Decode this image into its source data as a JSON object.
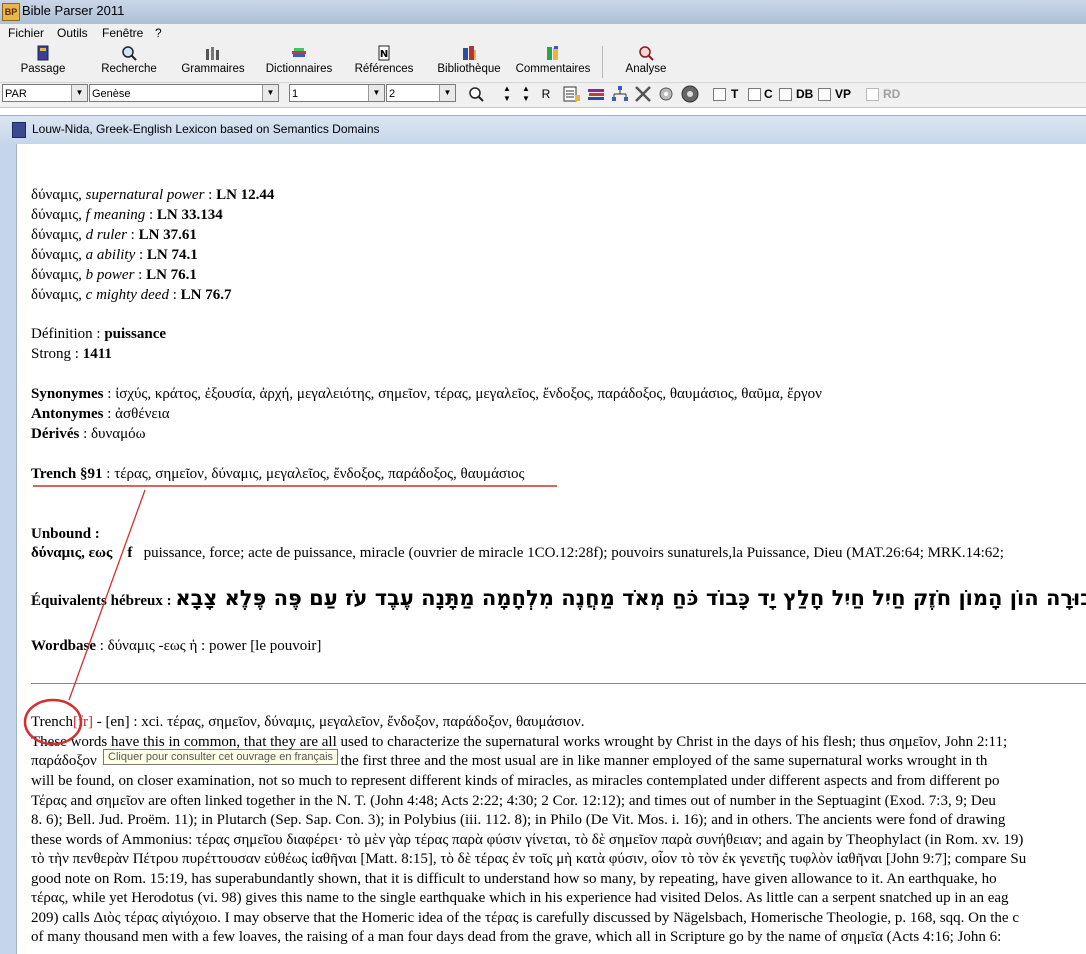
{
  "app": {
    "title": "Bible Parser 2011",
    "icon_text": "BP"
  },
  "menu": [
    "Fichier",
    "Outils",
    "Fenêtre",
    "?"
  ],
  "toolbar": {
    "buttons": [
      "Passage",
      "Recherche",
      "Grammaires",
      "Dictionnaires",
      "Références",
      "Bibliothèque",
      "Commentaires",
      "Analyse"
    ],
    "icons": [
      "book-icon",
      "magnifier-icon",
      "columns-icon",
      "dictionary-icon",
      "references-icon",
      "library-icon",
      "commentary-icon",
      "analysis-icon"
    ]
  },
  "toolbar2": {
    "version": "PAR",
    "book": "Genèse",
    "chapter": "1",
    "verse": "2",
    "r_label": "R",
    "checkboxes": [
      "T",
      "C",
      "DB",
      "VP",
      "RD"
    ]
  },
  "window": {
    "title": "Louw-Nida, Greek-English Lexicon based on Semantics Domains"
  },
  "entries": [
    {
      "word": "δύναμις, ",
      "sense": "supernatural power",
      "sep": " : ",
      "ref": "LN 12.44"
    },
    {
      "word": "δύναμις, ",
      "sense": "f meaning",
      "sep": " : ",
      "ref": "LN 33.134"
    },
    {
      "word": "δύναμις, ",
      "sense": "d ruler",
      "sep": " : ",
      "ref": "LN 37.61"
    },
    {
      "word": "δύναμις, ",
      "sense": "a ability",
      "sep": " : ",
      "ref": "LN 74.1"
    },
    {
      "word": "δύναμις, ",
      "sense": "b power",
      "sep": " : ",
      "ref": "LN 76.1"
    },
    {
      "word": "δύναμις, ",
      "sense": "c mighty deed",
      "sep": " : ",
      "ref": "LN 76.7"
    }
  ],
  "definition": {
    "label": "Définition : ",
    "value": "puissance"
  },
  "strong": {
    "label": "Strong : ",
    "value": "1411"
  },
  "synonymes": {
    "label": "Synonymes",
    "value": " : ἰσχύς, κράτος, ἐξουσία, ἀρχή, μεγαλειότης, σημεῖον, τέρας, μεγαλεῖος, ἔνδοξος, παράδοξος, θαυμάσιος, θαῦμα, ἔργον"
  },
  "antonymes": {
    "label": "Antonymes",
    "value": " : ἀσθένεια"
  },
  "derives": {
    "label": "Dérivés",
    "value": " : δυναμόω"
  },
  "trench_ref": {
    "label": "Trench §91",
    "value": " : τέρας, σημεῖον, δύναμις, μεγαλεῖος, ἔνδοξος, παράδοξος, θαυμάσιος"
  },
  "unbound": {
    "label": "Unbound :",
    "headword": "δύναμις, εως",
    "gender": "f",
    "text": "puissance, force; acte de puissance, miracle (ouvrier de miracle 1CO.12:28f); pouvoirs sunaturels,la Puissance, Dieu (MAT.26:64; MRK.14:62;"
  },
  "hebrew": {
    "label": "Équivalents hébreux : ",
    "value": "גְּבוּרָה הוֹן הָמוֹן חֹזֶק חַיִל חַיִל חָלַץ יָד כָּבוֹד כֹּחַ מְאֹד מַחֲנֶה מִלְחָמָה מַתָּנָה עֶבֶד עֹז עַם פֶּה פֶּלֶא צָבָא"
  },
  "wordbase": {
    "label": "Wordbase",
    "value": " : δύναμις -εως ἡ : power [le pouvoir]"
  },
  "trench_text": {
    "head": "Trench",
    "fr": "[fr]",
    "dash1": " - ",
    "en": "[en]",
    "rest": " : xci. τέρας, σημεῖον, δύναμις, μεγαλεῖον, ἔνδοξον, παράδοξον, θαυμάσιον.",
    "tooltip": "Cliquer pour consulter cet ouvrage en français",
    "lines": [
      "These words have this in common, that they are all used to characterize the supernatural works wrought by Christ in the days of his flesh; thus σημεῖον, John 2:11;",
      "παράδοξον                                                            ile the first three and the most usual are in like manner employed of the same supernatural works wrought in th",
      "will be found, on closer examination, not so much to represent different kinds of miracles, as miracles contemplated under different aspects and from different po",
      "Τέρας and σημεῖον are often linked together in the N. T. (John 4:48; Acts 2:22; 4:30; 2 Cor. 12:12); and times out of number in the Septuagint (Exod. 7:3, 9; Deu",
      "8. 6); Bell. Jud. Proëm. 11); in Plutarch (Sep. Sap. Con. 3); in Polybius (iii. 112. 8); in Philo (De Vit. Mos. i. 16); and in others. The ancients were fond of drawing",
      "these words of Ammonius: τέρας σημεῖου διαφέρει· τὸ μὲν γὰρ τέρας παρὰ φύσιν γίνεται, τὸ δὲ σημεῖον παρὰ συνήθειαν; and again by Theophylact (in Rom. xv. 19)",
      "τὸ τὴν πενθερὰν Πέτρου πυρέττουσαν εὐθέως ἰαθῆναι [Matt. 8:15], τὸ δὲ τέρας ἐν τοῖς μὴ κατὰ φύσιν, οἷον τὸ τὸν ἐκ γενετῆς τυφλὸν ἰαθῆναι [John 9:7]; compare Su",
      "good note on Rom. 15:19, has superabundantly shown, that it is difficult to understand how so many, by repeating, have given allowance to it. An earthquake, ho",
      "τέρας, while yet Herodotus (vi. 98) gives this name to the single earthquake which in his experience had visited Delos. As little can a serpent snatched up in an eag",
      "209) calls Διὸς τέρας αἰγιόχοιο. I may observe that the Homeric idea of the τέρας is carefully discussed by Nägelsbach, Homerische Theologie, p. 168, sqq. On the c",
      "of many thousand men with a few loaves, the raising of a man four days dead from the grave, which all in Scripture go by the name of σημεῖα (Acts 4:16; John 6:"
    ]
  },
  "colors": {
    "annotation": "#d32f2f",
    "link_red": "#c62828",
    "titlebar": "#c9d7e8"
  }
}
